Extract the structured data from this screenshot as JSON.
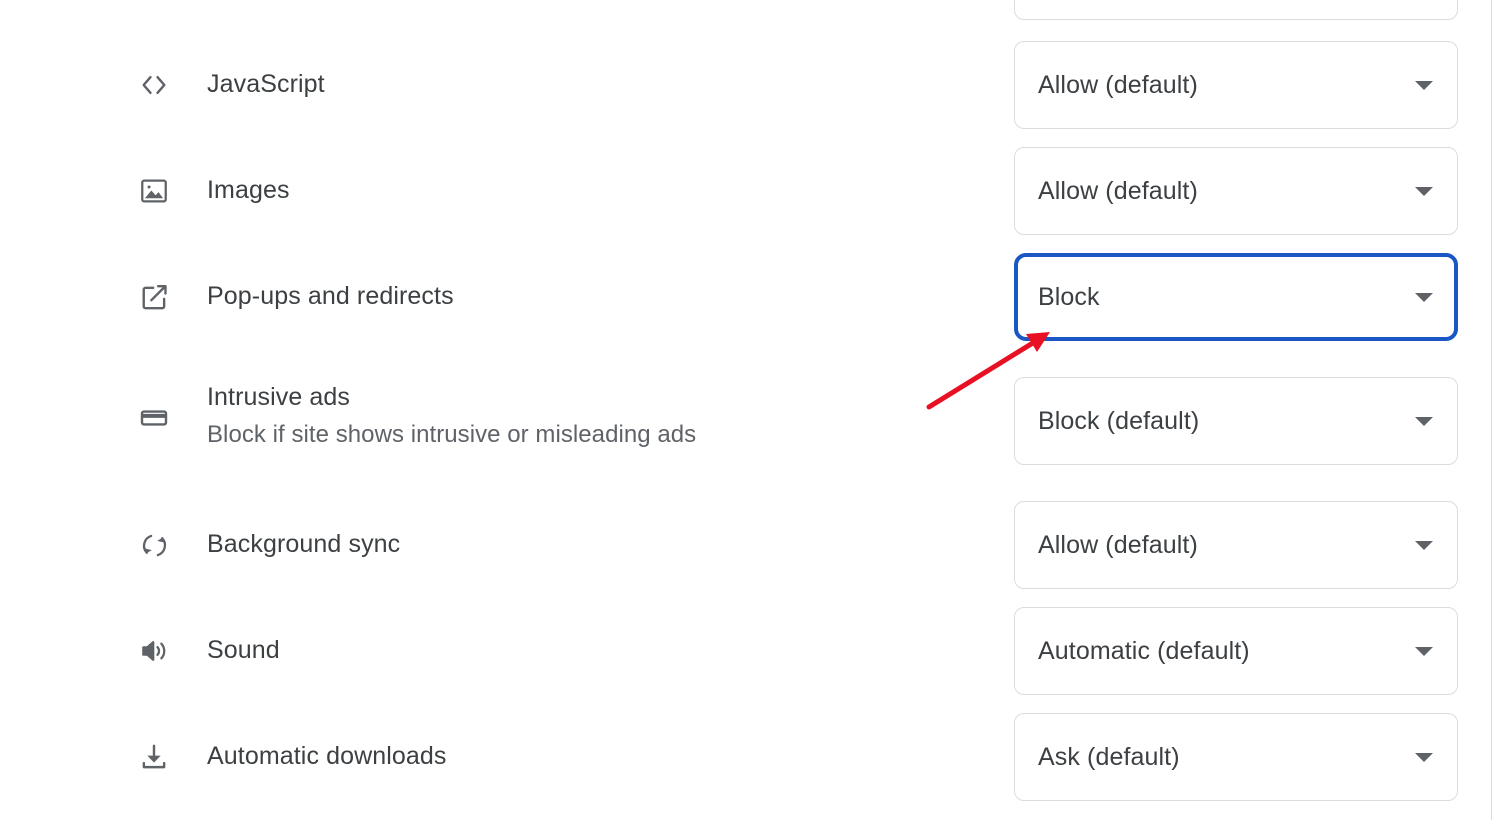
{
  "page": {
    "context": "Chrome Site settings — Content permissions list",
    "background_color": "#ffffff",
    "divider_color": "#dadce0"
  },
  "annotation": {
    "highlight_color": "#1a56c4",
    "arrow_color": "#e81123",
    "highlighted_control": "Pop-ups and redirects dropdown",
    "arrow_from": "930,406",
    "arrow_to": "1048,333"
  },
  "partial_row": {
    "dropdown_value": ""
  },
  "settings": [
    {
      "icon": "code-brackets-icon",
      "title": "JavaScript",
      "subtitle": "",
      "dropdown_value": "Allow (default)",
      "focused": false
    },
    {
      "icon": "image-icon",
      "title": "Images",
      "subtitle": "",
      "dropdown_value": "Allow (default)",
      "focused": false
    },
    {
      "icon": "external-link-icon",
      "title": "Pop-ups and redirects",
      "subtitle": "",
      "dropdown_value": "Block",
      "focused": true
    },
    {
      "icon": "ad-banner-icon",
      "title": "Intrusive ads",
      "subtitle": "Block if site shows intrusive or misleading ads",
      "dropdown_value": "Block (default)",
      "focused": false
    },
    {
      "icon": "sync-icon",
      "title": "Background sync",
      "subtitle": "",
      "dropdown_value": "Allow (default)",
      "focused": false
    },
    {
      "icon": "speaker-icon",
      "title": "Sound",
      "subtitle": "",
      "dropdown_value": "Automatic (default)",
      "focused": false
    },
    {
      "icon": "download-icon",
      "title": "Automatic downloads",
      "subtitle": "",
      "dropdown_value": "Ask (default)",
      "focused": false
    }
  ]
}
